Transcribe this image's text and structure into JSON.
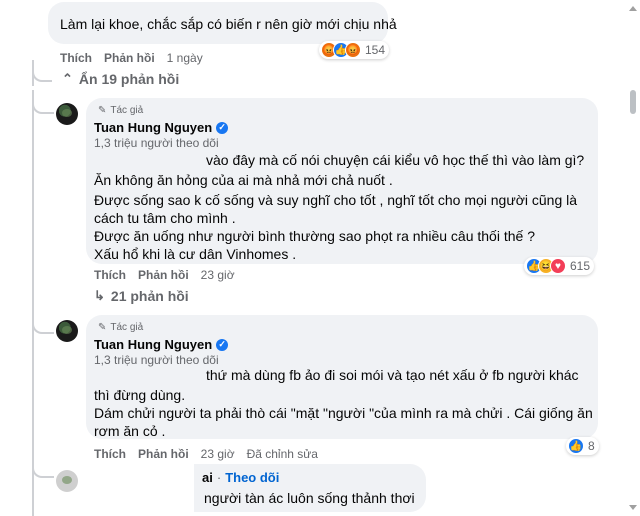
{
  "comment1": {
    "text": "Làm lại khoe, chắc sắp có biến r nên giờ mới chịu nhả",
    "like_label": "Thích",
    "reply_label": "Phản hồi",
    "time": "1 ngày",
    "reaction_icons": [
      "angry-icon",
      "like-icon",
      "angry-icon"
    ],
    "reaction_count": "154"
  },
  "hide_replies": {
    "label": "Ẩn 19 phản hồi"
  },
  "reply1": {
    "author_badge": "Tác giả",
    "author_name": "Tuan Hung Nguyen",
    "followers": "1,3 triệu người theo dõi",
    "lines": [
      "vào đây mà cố nói chuyện cái kiểu vô học thế thì vào làm gì?",
      "Ăn không ăn hỏng của ai mà nhả mới chả nuốt .",
      "Được sống sao k cố sống và suy nghĩ cho tốt , nghĩ tốt cho mọi người cũng là",
      "cách tu tâm cho mình .",
      "Được ăn uống như người bình thường sao phọt ra nhiều câu thối thế ?",
      "Xấu hổ khi là cư dân Vinhomes ."
    ],
    "like_label": "Thích",
    "reply_label": "Phản hồi",
    "time": "23 giờ",
    "reaction_icons": [
      "like-icon",
      "haha-icon",
      "love-icon"
    ],
    "reaction_count": "615"
  },
  "more_replies": {
    "label": "21 phản hồi"
  },
  "reply2": {
    "author_badge": "Tác giả",
    "author_name": "Tuan Hung Nguyen",
    "followers": "1,3 triệu người theo dõi",
    "lines": [
      "thứ mà dùng fb ảo đi soi mói và tạo nét xấu ở fb người khác",
      "thì đừng dùng.",
      "Dám chửi người ta phải thò cái \"mặt \"người \"của mình ra mà chửi . Cái giống ăn",
      "rơm ăn cỏ ."
    ],
    "like_label": "Thích",
    "reply_label": "Phản hồi",
    "time": "23 giờ",
    "edited_label": "Đã chỉnh sửa",
    "reaction_icons": [
      "like-icon"
    ],
    "reaction_count": "8"
  },
  "reply3": {
    "name_partial": "ai",
    "follow_label": "Theo dõi",
    "text": "người tàn ác luôn sống thảnh thơi"
  },
  "colors": {
    "bubble": "#f0f2f5",
    "secondary_text": "#65676b",
    "link": "#0064d1",
    "like": "#1877f2"
  }
}
